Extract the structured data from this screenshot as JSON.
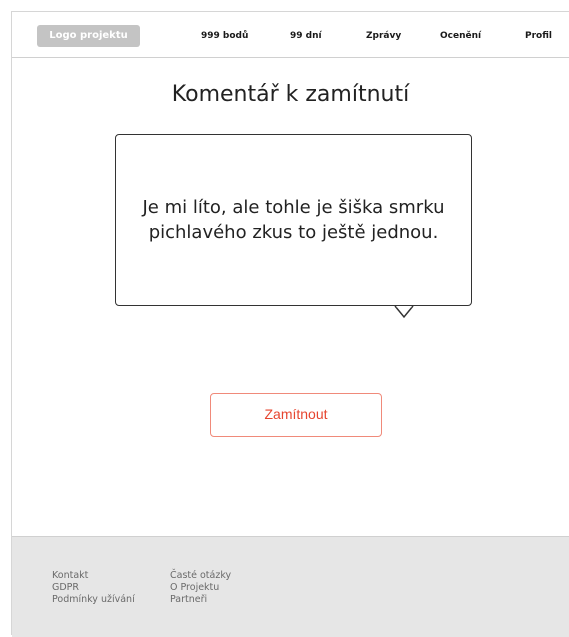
{
  "header": {
    "logo": "Logo projektu",
    "nav": {
      "points": "999 bodů",
      "days": "99 dní",
      "messages": "Zprávy",
      "awards": "Ocenění",
      "profile": "Profil"
    }
  },
  "main": {
    "title": "Komentář k zamítnutí",
    "comment_line1": "Je mi líto, ale tohle je šiška smrku",
    "comment_line2": "pichlavého zkus to ještě jednou.",
    "reject_button": "Zamítnout"
  },
  "footer": {
    "col1": [
      "Kontakt",
      "GDPR",
      "Podmínky užívání"
    ],
    "col2": [
      "Časté otázky",
      "O Projektu",
      "Partneři"
    ]
  },
  "colors": {
    "accent_red": "#e6452f",
    "footer_bg": "#e6e6e6",
    "logo_bg": "#c4c4c4"
  }
}
